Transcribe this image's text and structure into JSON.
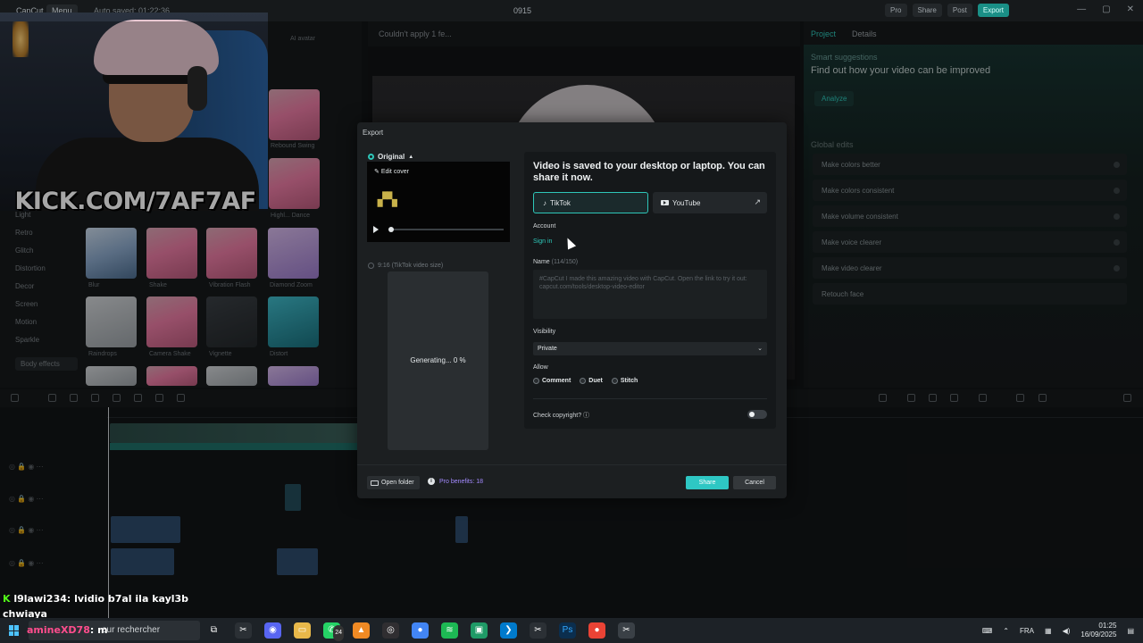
{
  "titlebar": {
    "app_name": "CapCut",
    "menu_label": "Menu",
    "autosave": "Auto saved: 01:22:36",
    "project_title": "0915",
    "pro_label": "Pro",
    "share_label": "Share",
    "post_label": "Post",
    "export_label": "Export"
  },
  "left_panel": {
    "categories": [
      "Light",
      "Retro",
      "Glitch",
      "Distortion",
      "Decor",
      "Screen",
      "Motion",
      "Sparkle"
    ],
    "body_effects_label": "Body effects",
    "tab_ai_avatar": "AI avatar",
    "thumbs": [
      {
        "label": "Rebound Swing"
      },
      {
        "label": "Highl... Dance"
      },
      {
        "label": "Blur"
      },
      {
        "label": "Shake"
      },
      {
        "label": "Vibration Flash"
      },
      {
        "label": "Diamond Zoom"
      },
      {
        "label": "Raindrops"
      },
      {
        "label": "Camera Shake"
      },
      {
        "label": "Vignette"
      },
      {
        "label": "Distort"
      }
    ]
  },
  "overlay": {
    "kick_brand": "KICK.COM/7AF7AF",
    "kick_letter": "K"
  },
  "player": {
    "status": "Couldn't apply 1 fe..."
  },
  "right_panel": {
    "tab_project": "Project",
    "tab_details": "Details",
    "smart_title": "Smart suggestions",
    "smart_subtitle": "Find out how your video can be improved",
    "analyze_label": "Analyze",
    "global_title": "Global edits",
    "global_edits": [
      "Make colors better",
      "Make colors consistent",
      "Make volume consistent",
      "Make voice clearer",
      "Make video clearer",
      "Retouch face"
    ]
  },
  "export_dialog": {
    "title": "Export",
    "original_label": "Original",
    "edit_cover_label": "Edit cover",
    "vertical_label": "9:16 (TikTok video size)",
    "generating_text": "Generating... 0 %",
    "share_heading": "Video is saved to your desktop or laptop. You can share it now.",
    "tiktok_label": "TikTok",
    "youtube_label": "YouTube",
    "account_label": "Account",
    "sign_in_label": "Sign in",
    "name_label": "Name",
    "name_count": "(114/150)",
    "name_placeholder": "#CapCut I made this amazing video with CapCut. Open the link to try it out: capcut.com/tools/desktop-video-editor",
    "visibility_label": "Visibility",
    "visibility_value": "Private",
    "allow_label": "Allow",
    "allow_options": [
      "Comment",
      "Duet",
      "Stitch"
    ],
    "copyright_label": "Check copyright?",
    "open_folder_label": "Open folder",
    "pro_benefits_label": "Pro benefits: 18",
    "share_button": "Share",
    "cancel_button": "Cancel"
  },
  "chat": {
    "line1_user": "l9lawi234",
    "line1_msg": ": lvidio b7al ila kayl3b",
    "line2_msg": "chwiaya",
    "line3_user": "amineXD78",
    "line3_msg": ": m"
  },
  "taskbar": {
    "search_placeholder": "our rechercher",
    "lang": "FRA",
    "time": "01:25",
    "date": "16/09/2025",
    "badge": "24"
  },
  "colors": {
    "accent": "#2ec7b9",
    "kick_green": "#53fc18",
    "pro_purple": "#a38aff"
  }
}
